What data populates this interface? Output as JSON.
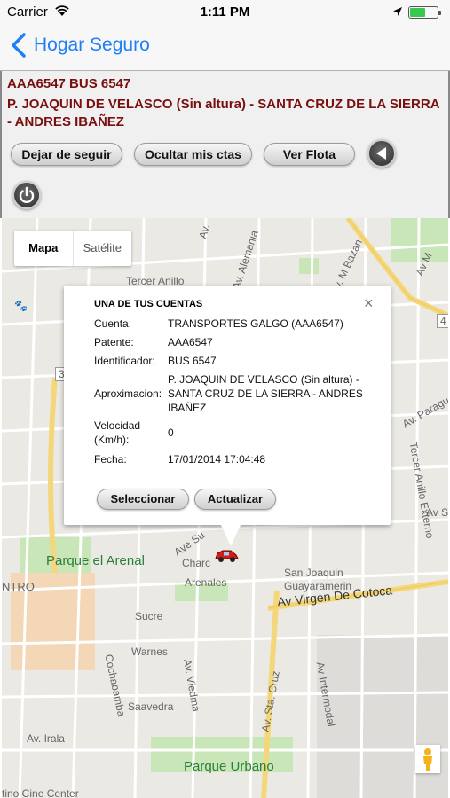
{
  "status_bar": {
    "carrier": "Carrier",
    "time": "1:11 PM",
    "battery_level": 0.55
  },
  "nav": {
    "back_label": "Hogar Seguro"
  },
  "header": {
    "vehicle": "AAA6547 BUS 6547",
    "location": "P. JOAQUIN DE VELASCO (Sin altura) - SANTA CRUZ DE LA SIERRA - ANDRES IBAÑEZ"
  },
  "buttons": {
    "unfollow": "Dejar de seguir",
    "hide_accounts": "Ocultar mis ctas",
    "view_fleet": "Ver Flota"
  },
  "map": {
    "type_map": "Mapa",
    "type_satellite": "Satélite",
    "labels": {
      "av_alemania": "Av. Alemania",
      "tercer_anillo": "Tercer Anillo",
      "av_bazan": "Av. M Bazan",
      "av_paragua": "Av. Paragua",
      "tercer_anillo_externo": "Tercer Anillo Externo",
      "parque_arenal": "Parque el Arenal",
      "ntro": "NTRO",
      "charc": "Charc",
      "arenales": "Arenales",
      "sucre": "Sucre",
      "warnes": "Warnes",
      "san_joaquin": "San Joaquin",
      "guayaramerin": "Guayaramerin",
      "av_virgen": "Av Virgen De Cotoca",
      "cochabamba": "Cochabamba",
      "saavedra": "Saavedra",
      "av_irala": "Av. Irala",
      "av_viedma": "Av. Viedma",
      "av_sta_cruz": "Av. Sta. Cruz",
      "av_intermodal": "Av Intermodal",
      "parque_urbano": "Parque Urbano",
      "av_s": "Av S",
      "ave_su": "Ave Su",
      "av_m": "Av M",
      "av_top": "Av.",
      "road_4": "4",
      "road_3": "3",
      "bottom_cut": "tino Cine Center"
    }
  },
  "popup": {
    "title": "UNA DE TUS CUENTAS",
    "close": "×",
    "rows": [
      {
        "label": "Cuenta:",
        "value": "TRANSPORTES GALGO (AAA6547)"
      },
      {
        "label": "Patente:",
        "value": "AAA6547"
      },
      {
        "label": "Identificador:",
        "value": "BUS 6547"
      },
      {
        "label": "Aproximacion:",
        "value": "P. JOAQUIN DE VELASCO (Sin altura) - SANTA CRUZ DE LA SIERRA - ANDRES IBAÑEZ"
      },
      {
        "label": "Velocidad (Km/h):",
        "value": "0"
      },
      {
        "label": "Fecha:",
        "value": "17/01/2014 17:04:48"
      }
    ],
    "select_label": "Seleccionar",
    "update_label": "Actualizar"
  }
}
